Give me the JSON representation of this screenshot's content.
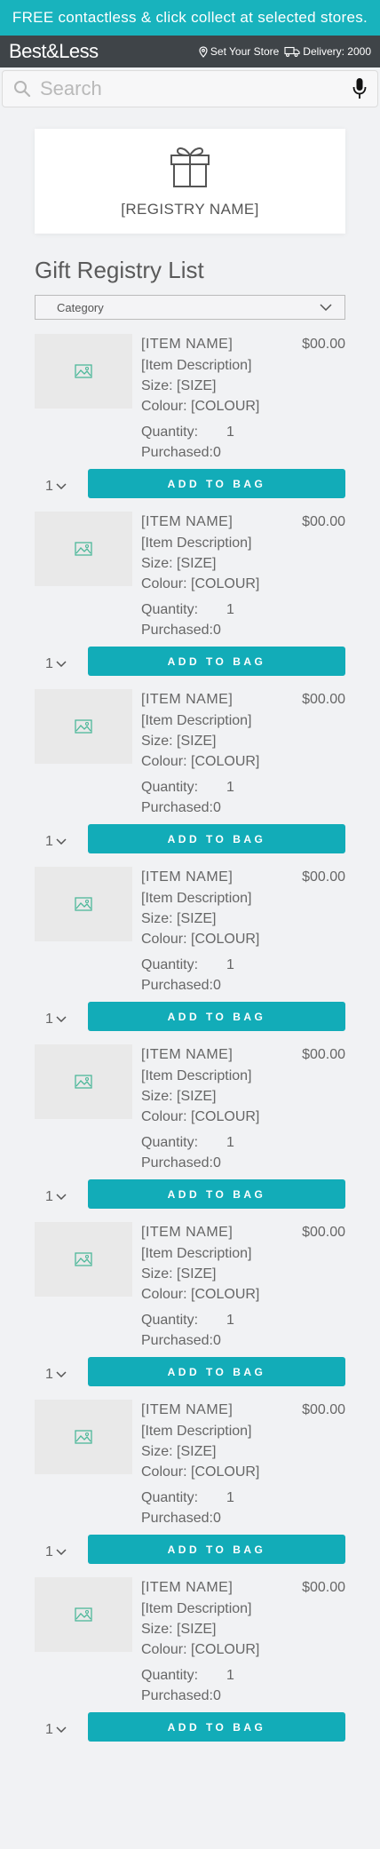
{
  "promo": {
    "text": "FREE contactless & click collect at selected stores."
  },
  "header": {
    "logo": "Best&Less",
    "store_label": "Set Your Store",
    "delivery_label": "Delivery: 2000"
  },
  "search": {
    "placeholder": "Search"
  },
  "registry": {
    "name": "[REGISTRY NAME]"
  },
  "list": {
    "title": "Gift Registry List",
    "category_label": "Category",
    "items": [
      {
        "name": "[ITEM NAME]",
        "price": "$00.00",
        "description": "[Item Description]",
        "size": "Size: [SIZE]",
        "colour": "Colour: [COLOUR]",
        "quantity_label": "Quantity:",
        "quantity": "1",
        "purchased_label": "Purchased:",
        "purchased": "0",
        "qty_select": "1",
        "button": "ADD TO BAG"
      },
      {
        "name": "[ITEM NAME]",
        "price": "$00.00",
        "description": "[Item Description]",
        "size": "Size: [SIZE]",
        "colour": "Colour: [COLOUR]",
        "quantity_label": "Quantity:",
        "quantity": "1",
        "purchased_label": "Purchased:",
        "purchased": "0",
        "qty_select": "1",
        "button": "ADD TO BAG"
      },
      {
        "name": "[ITEM NAME]",
        "price": "$00.00",
        "description": "[Item Description]",
        "size": "Size: [SIZE]",
        "colour": "Colour: [COLOUR]",
        "quantity_label": "Quantity:",
        "quantity": "1",
        "purchased_label": "Purchased:",
        "purchased": "0",
        "qty_select": "1",
        "button": "ADD TO BAG"
      },
      {
        "name": "[ITEM NAME]",
        "price": "$00.00",
        "description": "[Item Description]",
        "size": "Size: [SIZE]",
        "colour": "Colour: [COLOUR]",
        "quantity_label": "Quantity:",
        "quantity": "1",
        "purchased_label": "Purchased:",
        "purchased": "0",
        "qty_select": "1",
        "button": "ADD TO BAG"
      },
      {
        "name": "[ITEM NAME]",
        "price": "$00.00",
        "description": "[Item Description]",
        "size": "Size: [SIZE]",
        "colour": "Colour: [COLOUR]",
        "quantity_label": "Quantity:",
        "quantity": "1",
        "purchased_label": "Purchased:",
        "purchased": "0",
        "qty_select": "1",
        "button": "ADD TO BAG"
      },
      {
        "name": "[ITEM NAME]",
        "price": "$00.00",
        "description": "[Item Description]",
        "size": "Size: [SIZE]",
        "colour": "Colour: [COLOUR]",
        "quantity_label": "Quantity:",
        "quantity": "1",
        "purchased_label": "Purchased:",
        "purchased": "0",
        "qty_select": "1",
        "button": "ADD TO BAG"
      },
      {
        "name": "[ITEM NAME]",
        "price": "$00.00",
        "description": "[Item Description]",
        "size": "Size: [SIZE]",
        "colour": "Colour: [COLOUR]",
        "quantity_label": "Quantity:",
        "quantity": "1",
        "purchased_label": "Purchased:",
        "purchased": "0",
        "qty_select": "1",
        "button": "ADD TO BAG"
      },
      {
        "name": "[ITEM NAME]",
        "price": "$00.00",
        "description": "[Item Description]",
        "size": "Size: [SIZE]",
        "colour": "Colour: [COLOUR]",
        "quantity_label": "Quantity:",
        "quantity": "1",
        "purchased_label": "Purchased:",
        "purchased": "0",
        "qty_select": "1",
        "button": "ADD TO BAG"
      }
    ]
  },
  "colors": {
    "accent": "#12acb8",
    "promo_bg": "#18b3bd",
    "header_bg": "#3f4448",
    "page_bg": "#f1f2f4"
  },
  "icons": {
    "store": "pin-icon",
    "delivery": "truck-icon",
    "search": "search-icon",
    "voice": "microphone-icon",
    "registry": "gift-icon",
    "placeholder": "image-placeholder-icon",
    "dropdown": "chevron-down-icon"
  }
}
